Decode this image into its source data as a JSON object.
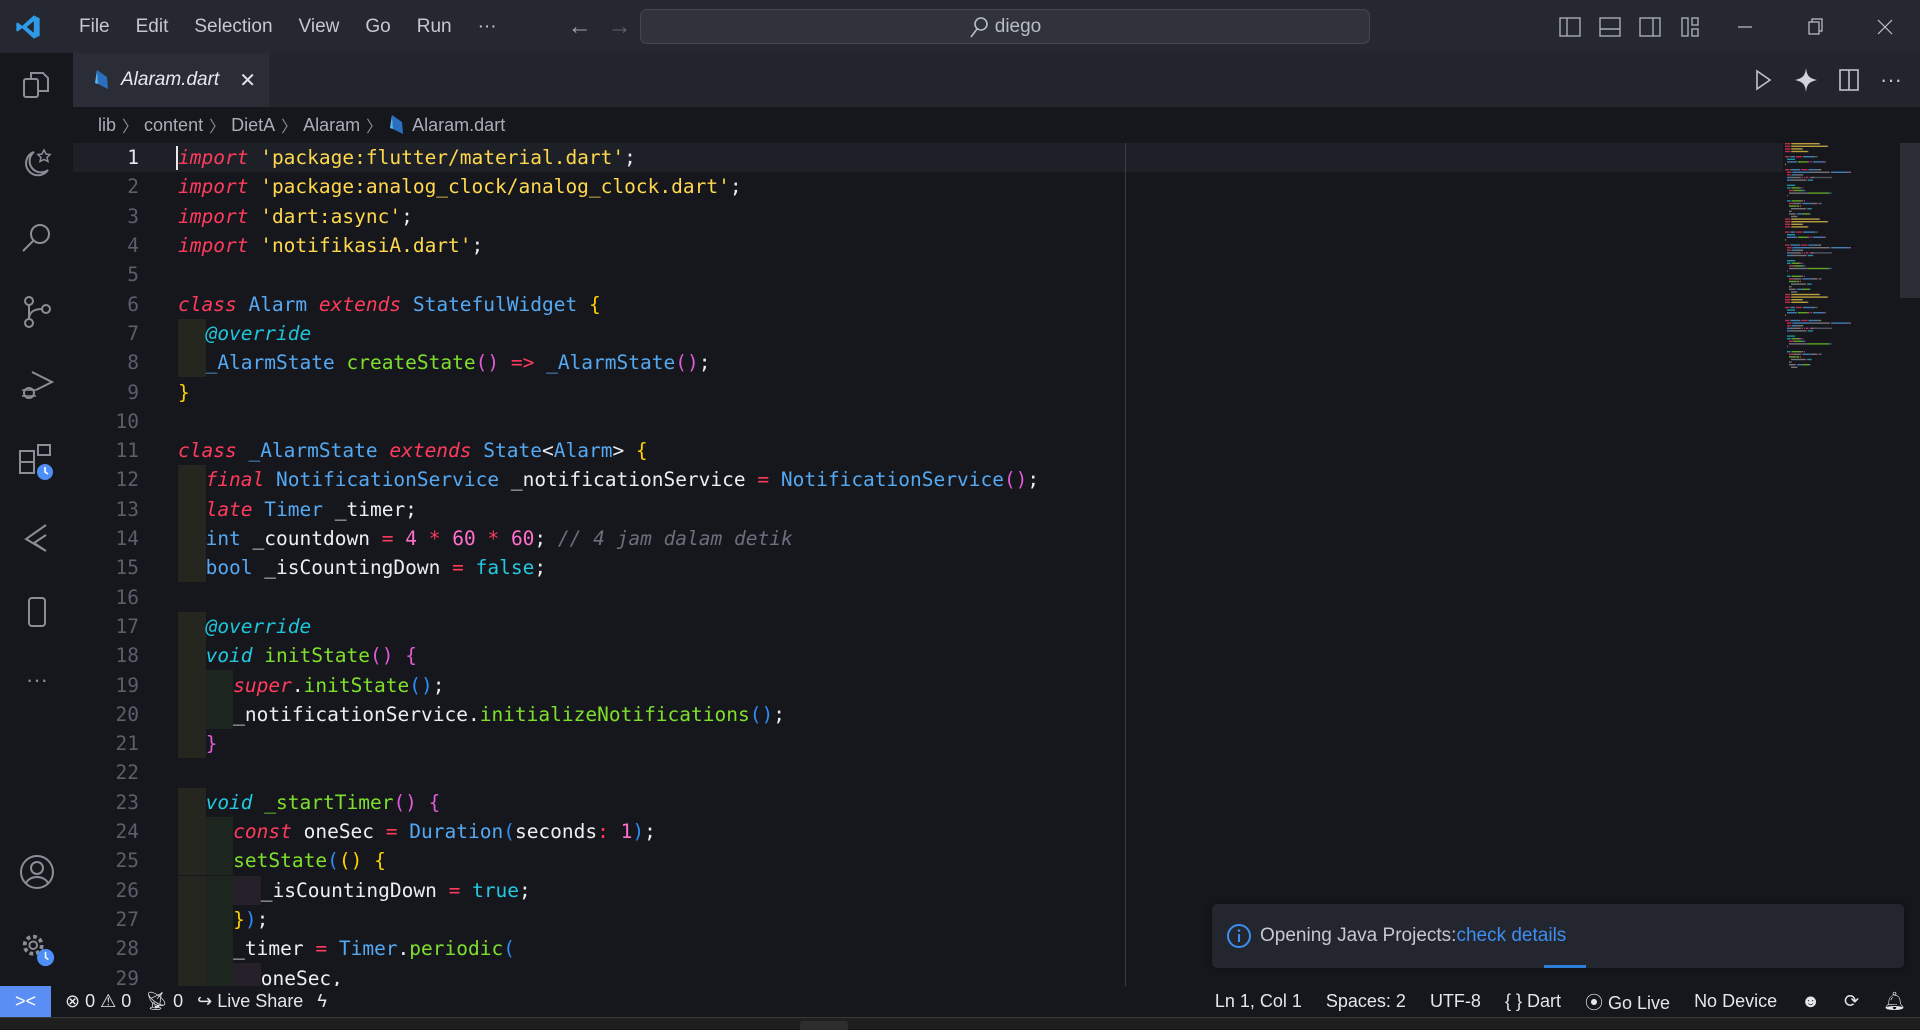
{
  "titlebar": {
    "menu": [
      "File",
      "Edit",
      "Selection",
      "View",
      "Go",
      "Run",
      "···"
    ],
    "back": "←",
    "forward": "→",
    "search_text": "diego"
  },
  "tab": {
    "name": "Alaram.dart",
    "close": "✕"
  },
  "breadcrumb": [
    "lib",
    "content",
    "DietA",
    "Alaram",
    "Alaram.dart"
  ],
  "editor": {
    "current_line": 1,
    "lines": [
      {
        "n": "1",
        "indent": 0,
        "t": [
          [
            "import",
            "kw"
          ],
          [
            " ",
            "pl"
          ],
          [
            "'package:flutter/material.dart'",
            "str"
          ],
          [
            ";",
            "pl"
          ]
        ]
      },
      {
        "n": "2",
        "indent": 0,
        "t": [
          [
            "import",
            "kw"
          ],
          [
            " ",
            "pl"
          ],
          [
            "'package:analog_clock/analog_clock.dart'",
            "str"
          ],
          [
            ";",
            "pl"
          ]
        ]
      },
      {
        "n": "3",
        "indent": 0,
        "t": [
          [
            "import",
            "kw"
          ],
          [
            " ",
            "pl"
          ],
          [
            "'dart:async'",
            "str"
          ],
          [
            ";",
            "pl"
          ]
        ]
      },
      {
        "n": "4",
        "indent": 0,
        "t": [
          [
            "import",
            "kw"
          ],
          [
            " ",
            "pl"
          ],
          [
            "'notifikasiA.dart'",
            "str"
          ],
          [
            ";",
            "pl"
          ]
        ]
      },
      {
        "n": "5",
        "indent": 0,
        "t": []
      },
      {
        "n": "6",
        "indent": 0,
        "t": [
          [
            "class",
            "kw"
          ],
          [
            " ",
            "pl"
          ],
          [
            "Alarm",
            "ty"
          ],
          [
            " ",
            "pl"
          ],
          [
            "extends",
            "kw"
          ],
          [
            " ",
            "pl"
          ],
          [
            "StatefulWidget",
            "ty"
          ],
          [
            " ",
            "pl"
          ],
          [
            "{",
            "b1"
          ]
        ]
      },
      {
        "n": "7",
        "indent": 1,
        "t": [
          [
            "@override",
            "an"
          ]
        ]
      },
      {
        "n": "8",
        "indent": 1,
        "t": [
          [
            "_AlarmState",
            "ty"
          ],
          [
            " ",
            "pl"
          ],
          [
            "createState",
            "fn"
          ],
          [
            "()",
            "b2"
          ],
          [
            " ",
            "pl"
          ],
          [
            "=>",
            "op"
          ],
          [
            " ",
            "pl"
          ],
          [
            "_AlarmState",
            "ty"
          ],
          [
            "()",
            "b2"
          ],
          [
            ";",
            "pl"
          ]
        ]
      },
      {
        "n": "9",
        "indent": 0,
        "t": [
          [
            "}",
            "b1"
          ]
        ]
      },
      {
        "n": "10",
        "indent": 0,
        "t": []
      },
      {
        "n": "11",
        "indent": 0,
        "t": [
          [
            "class",
            "kw"
          ],
          [
            " ",
            "pl"
          ],
          [
            "_AlarmState",
            "ty"
          ],
          [
            " ",
            "pl"
          ],
          [
            "extends",
            "kw"
          ],
          [
            " ",
            "pl"
          ],
          [
            "State",
            "ty"
          ],
          [
            "<",
            "pl"
          ],
          [
            "Alarm",
            "ty"
          ],
          [
            "> ",
            "pl"
          ],
          [
            "{",
            "b1"
          ]
        ]
      },
      {
        "n": "12",
        "indent": 1,
        "t": [
          [
            "final",
            "kw"
          ],
          [
            " ",
            "pl"
          ],
          [
            "NotificationService",
            "ty"
          ],
          [
            " _notificationService ",
            "pl"
          ],
          [
            "=",
            "op"
          ],
          [
            " ",
            "pl"
          ],
          [
            "NotificationService",
            "ty"
          ],
          [
            "()",
            "b2"
          ],
          [
            ";",
            "pl"
          ]
        ]
      },
      {
        "n": "13",
        "indent": 1,
        "t": [
          [
            "late",
            "kw"
          ],
          [
            " ",
            "pl"
          ],
          [
            "Timer",
            "ty"
          ],
          [
            " _timer;",
            "pl"
          ]
        ]
      },
      {
        "n": "14",
        "indent": 1,
        "t": [
          [
            "int",
            "bi"
          ],
          [
            " _countdown ",
            "pl"
          ],
          [
            "=",
            "op"
          ],
          [
            " ",
            "pl"
          ],
          [
            "4",
            "num"
          ],
          [
            " ",
            "pl"
          ],
          [
            "*",
            "op"
          ],
          [
            " ",
            "pl"
          ],
          [
            "60",
            "num"
          ],
          [
            " ",
            "pl"
          ],
          [
            "*",
            "op"
          ],
          [
            " ",
            "pl"
          ],
          [
            "60",
            "num"
          ],
          [
            "; ",
            "pl"
          ],
          [
            "// 4 jam dalam detik",
            "cm"
          ]
        ]
      },
      {
        "n": "15",
        "indent": 1,
        "t": [
          [
            "bool",
            "bi"
          ],
          [
            " _isCountingDown ",
            "pl"
          ],
          [
            "=",
            "op"
          ],
          [
            " ",
            "pl"
          ],
          [
            "false",
            "lit"
          ],
          [
            ";",
            "pl"
          ]
        ]
      },
      {
        "n": "16",
        "indent": 0,
        "t": []
      },
      {
        "n": "17",
        "indent": 1,
        "t": [
          [
            "@override",
            "an"
          ]
        ]
      },
      {
        "n": "18",
        "indent": 1,
        "t": [
          [
            "void",
            "vd"
          ],
          [
            " ",
            "pl"
          ],
          [
            "initState",
            "fn"
          ],
          [
            "()",
            "b2"
          ],
          [
            " ",
            "pl"
          ],
          [
            "{",
            "b2"
          ]
        ]
      },
      {
        "n": "19",
        "indent": 2,
        "t": [
          [
            "super",
            "kw"
          ],
          [
            ".",
            "pl"
          ],
          [
            "initState",
            "fn"
          ],
          [
            "()",
            "b3"
          ],
          [
            ";",
            "pl"
          ]
        ]
      },
      {
        "n": "20",
        "indent": 2,
        "t": [
          [
            "_notificationService.",
            "pl"
          ],
          [
            "initializeNotifications",
            "fn"
          ],
          [
            "()",
            "b3"
          ],
          [
            ";",
            "pl"
          ]
        ]
      },
      {
        "n": "21",
        "indent": 1,
        "t": [
          [
            "}",
            "b2"
          ]
        ]
      },
      {
        "n": "22",
        "indent": 0,
        "t": []
      },
      {
        "n": "23",
        "indent": 1,
        "t": [
          [
            "void",
            "vd"
          ],
          [
            " ",
            "pl"
          ],
          [
            "_startTimer",
            "fn"
          ],
          [
            "()",
            "b2"
          ],
          [
            " ",
            "pl"
          ],
          [
            "{",
            "b2"
          ]
        ]
      },
      {
        "n": "24",
        "indent": 2,
        "t": [
          [
            "const",
            "kw"
          ],
          [
            " oneSec ",
            "pl"
          ],
          [
            "=",
            "op"
          ],
          [
            " ",
            "pl"
          ],
          [
            "Duration",
            "ty"
          ],
          [
            "(",
            "b3"
          ],
          [
            "seconds",
            "pl"
          ],
          [
            ":",
            "op"
          ],
          [
            " ",
            "pl"
          ],
          [
            "1",
            "num"
          ],
          [
            ")",
            "b3"
          ],
          [
            ";",
            "pl"
          ]
        ]
      },
      {
        "n": "25",
        "indent": 2,
        "t": [
          [
            "setState",
            "fn"
          ],
          [
            "(",
            "b3"
          ],
          [
            "()",
            "b1"
          ],
          [
            " ",
            "pl"
          ],
          [
            "{",
            "b1"
          ]
        ]
      },
      {
        "n": "26",
        "indent": 3,
        "t": [
          [
            "_isCountingDown ",
            "pl"
          ],
          [
            "=",
            "op"
          ],
          [
            " ",
            "pl"
          ],
          [
            "true",
            "lit"
          ],
          [
            ";",
            "pl"
          ]
        ]
      },
      {
        "n": "27",
        "indent": 2,
        "t": [
          [
            "}",
            "b1"
          ],
          [
            ")",
            "b3"
          ],
          [
            ";",
            "pl"
          ]
        ]
      },
      {
        "n": "28",
        "indent": 2,
        "t": [
          [
            "_timer ",
            "pl"
          ],
          [
            "=",
            "op"
          ],
          [
            " ",
            "pl"
          ],
          [
            "Timer",
            "ty"
          ],
          [
            ".",
            "pl"
          ],
          [
            "periodic",
            "fn"
          ],
          [
            "(",
            "b3"
          ]
        ]
      },
      {
        "n": "29",
        "indent": 3,
        "t": [
          [
            "oneSec,",
            "pl"
          ]
        ]
      }
    ]
  },
  "notification": {
    "icon": "info-icon",
    "text": "Opening Java Projects: ",
    "link": "check details"
  },
  "statusbar": {
    "errors": "0",
    "warnings": "0",
    "ports": "0",
    "live_share": "Live Share",
    "position": "Ln 1, Col 1",
    "spaces": "Spaces: 2",
    "encoding": "UTF-8",
    "language": "Dart",
    "go_live": "Go Live",
    "device": "No Device"
  },
  "colors": {
    "accent": "#5a8ef5",
    "link": "#3d8ef0",
    "keyword": "#ff3b5c",
    "string": "#ffd84d",
    "type": "#55a9f2",
    "function": "#7fe02c"
  }
}
